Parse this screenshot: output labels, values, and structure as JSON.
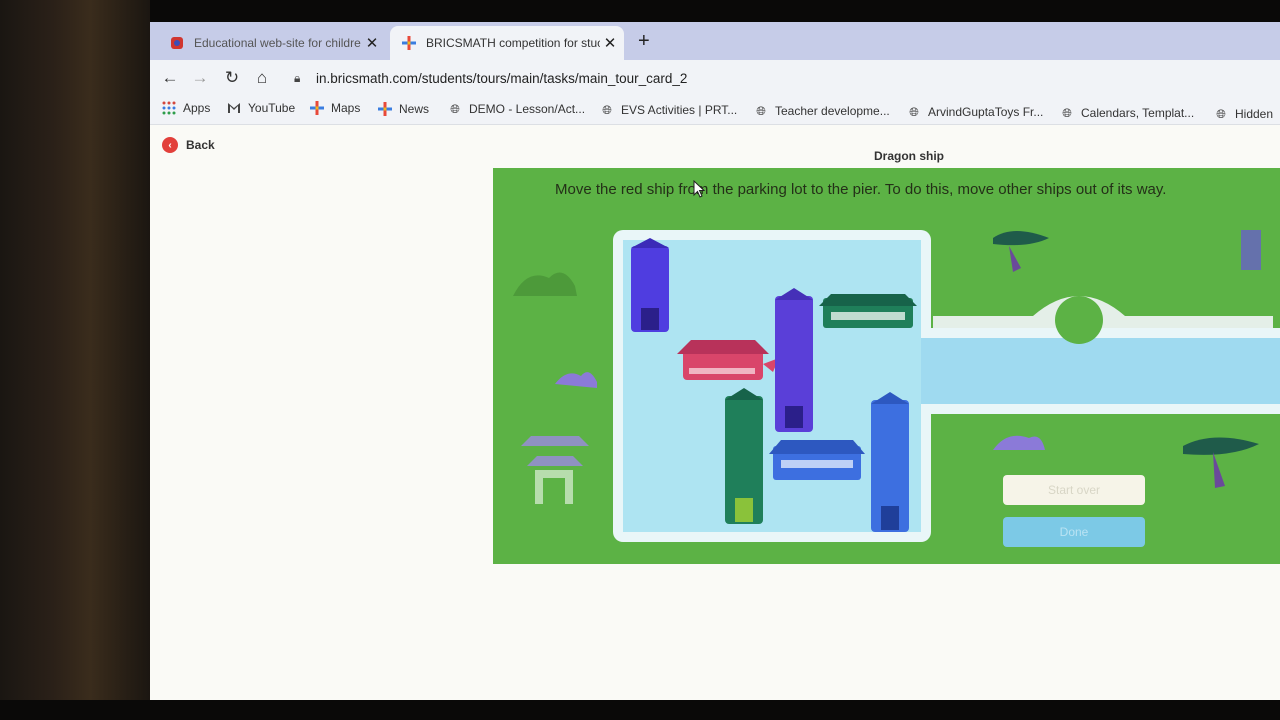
{
  "browser": {
    "tabs": [
      {
        "title": "Educational web-site for childre",
        "active": false
      },
      {
        "title": "BRICSMATH competition for stuc",
        "active": true
      }
    ],
    "new_tab_symbol": "+",
    "url": "in.bricsmath.com/students/tours/main/tasks/main_tour_card_2",
    "bookmarks": [
      {
        "label": "Apps",
        "icon": "apps-grid-icon"
      },
      {
        "label": "YouTube",
        "icon": "gmail-icon"
      },
      {
        "label": "Maps",
        "icon": "plus-color-icon"
      },
      {
        "label": "News",
        "icon": "plus-color-icon"
      },
      {
        "label": "DEMO - Lesson/Act...",
        "icon": "globe-icon"
      },
      {
        "label": "EVS Activities | PRT...",
        "icon": "globe-icon"
      },
      {
        "label": "Teacher developme...",
        "icon": "globe-icon"
      },
      {
        "label": "ArvindGuptaToys Fr...",
        "icon": "globe-icon"
      },
      {
        "label": "Calendars, Templat...",
        "icon": "globe-icon"
      },
      {
        "label": "Hidden",
        "icon": "globe-icon"
      }
    ]
  },
  "page": {
    "back_label": "Back",
    "task_title": "Dragon ship",
    "instruction": "Move the red ship from the parking lot to the pier. To do this, move other ships out of its way.",
    "buttons": {
      "start_over": "Start over",
      "done": "Done"
    }
  },
  "colors": {
    "game_green": "#5cb245",
    "water": "#aee4f2",
    "red_ship": "#d9456a",
    "blue_ship": "#3d6fe0",
    "purple_ship": "#5a3fd8",
    "teal_ship": "#1f7f5a"
  }
}
